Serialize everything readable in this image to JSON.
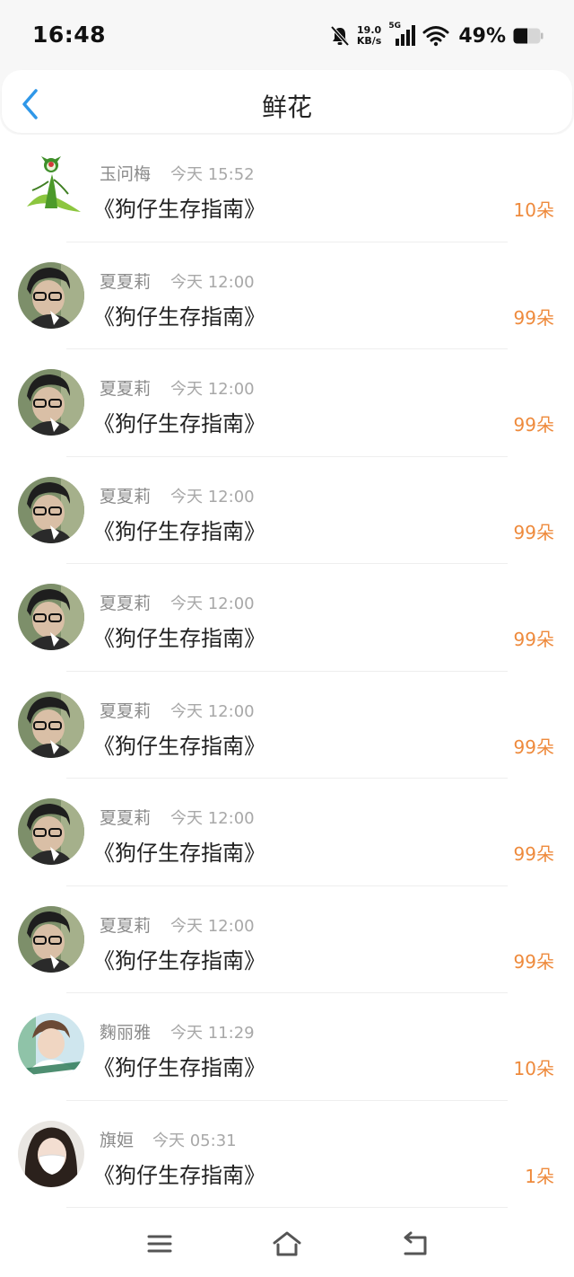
{
  "status": {
    "time": "16:48",
    "net_speed_value": "19.0",
    "net_speed_unit": "KB/s",
    "network": "5G",
    "battery": "49%",
    "icons": [
      "bell-off-icon",
      "signal-icon",
      "wifi-icon",
      "battery-icon"
    ]
  },
  "header": {
    "title": "鲜花",
    "back_icon": "chevron-left-icon"
  },
  "items": [
    {
      "name": "玉问梅",
      "time": "今天 15:52",
      "book": "《狗仔生存指南》",
      "count": "10朵",
      "avatar": "plant"
    },
    {
      "name": "夏夏莉",
      "time": "今天 12:00",
      "book": "《狗仔生存指南》",
      "count": "99朵",
      "avatar": "boy-glasses"
    },
    {
      "name": "夏夏莉",
      "time": "今天 12:00",
      "book": "《狗仔生存指南》",
      "count": "99朵",
      "avatar": "boy-glasses"
    },
    {
      "name": "夏夏莉",
      "time": "今天 12:00",
      "book": "《狗仔生存指南》",
      "count": "99朵",
      "avatar": "boy-glasses"
    },
    {
      "name": "夏夏莉",
      "time": "今天 12:00",
      "book": "《狗仔生存指南》",
      "count": "99朵",
      "avatar": "boy-glasses"
    },
    {
      "name": "夏夏莉",
      "time": "今天 12:00",
      "book": "《狗仔生存指南》",
      "count": "99朵",
      "avatar": "boy-glasses"
    },
    {
      "name": "夏夏莉",
      "time": "今天 12:00",
      "book": "《狗仔生存指南》",
      "count": "99朵",
      "avatar": "boy-glasses"
    },
    {
      "name": "夏夏莉",
      "time": "今天 12:00",
      "book": "《狗仔生存指南》",
      "count": "99朵",
      "avatar": "boy-glasses"
    },
    {
      "name": "麴丽雅",
      "time": "今天 11:29",
      "book": "《狗仔生存指南》",
      "count": "10朵",
      "avatar": "boy-white"
    },
    {
      "name": "旗姮",
      "time": "今天 05:31",
      "book": "《狗仔生存指南》",
      "count": "1朵",
      "avatar": "girl-mask"
    }
  ],
  "navbar": {
    "icons": [
      "menu-icon",
      "home-icon",
      "back-icon"
    ]
  },
  "colors": {
    "accent": "#2f97e8",
    "count": "#ee8a3c",
    "name": "#8a8a8a",
    "time": "#a8a8a8"
  }
}
